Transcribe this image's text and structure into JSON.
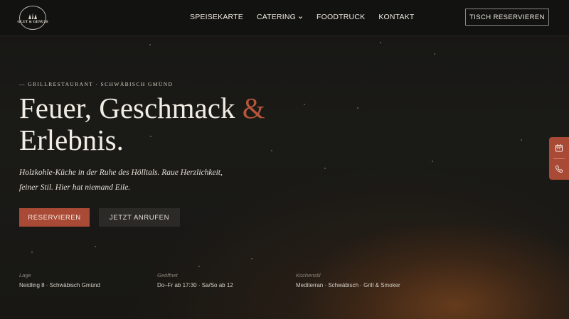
{
  "header": {
    "logo_text": "GLUT & GENUSS",
    "nav": [
      {
        "label": "SPEISEKARTE"
      },
      {
        "label": "CATERING"
      },
      {
        "label": "FOODTRUCK"
      },
      {
        "label": "KONTAKT"
      }
    ],
    "cta_label": "TISCH RESERVIEREN"
  },
  "hero": {
    "eyebrow": "— GRILLRESTAURANT · SCHWÄBISCH GMÜND",
    "title_part1": "Feuer, Geschmack ",
    "title_amp": "&",
    "title_part2": "Erlebnis.",
    "lede_line1": "Holzkohle-Küche in der Ruhe des Hölltals. Raue Herzlichkeit,",
    "lede_line2": "feiner Stil. Hier hat niemand Eile.",
    "btn_primary": "RESERVIEREN",
    "btn_secondary": "JETZT ANRUFEN"
  },
  "info": [
    {
      "label": "Lage",
      "value": "Neidling 8 · Schwäbisch Gmünd"
    },
    {
      "label": "Geöffnet",
      "value": "Do–Fr ab 17:30 · Sa/So ab 12"
    },
    {
      "label": "Küchenstil",
      "value": "Mediterran · Schwäbisch · Grill & Smoker"
    }
  ],
  "side": {
    "icons": [
      "calendar-icon",
      "phone-icon"
    ]
  },
  "colors": {
    "accent": "#a84a35",
    "background": "#151412",
    "text": "#f2ede4"
  }
}
